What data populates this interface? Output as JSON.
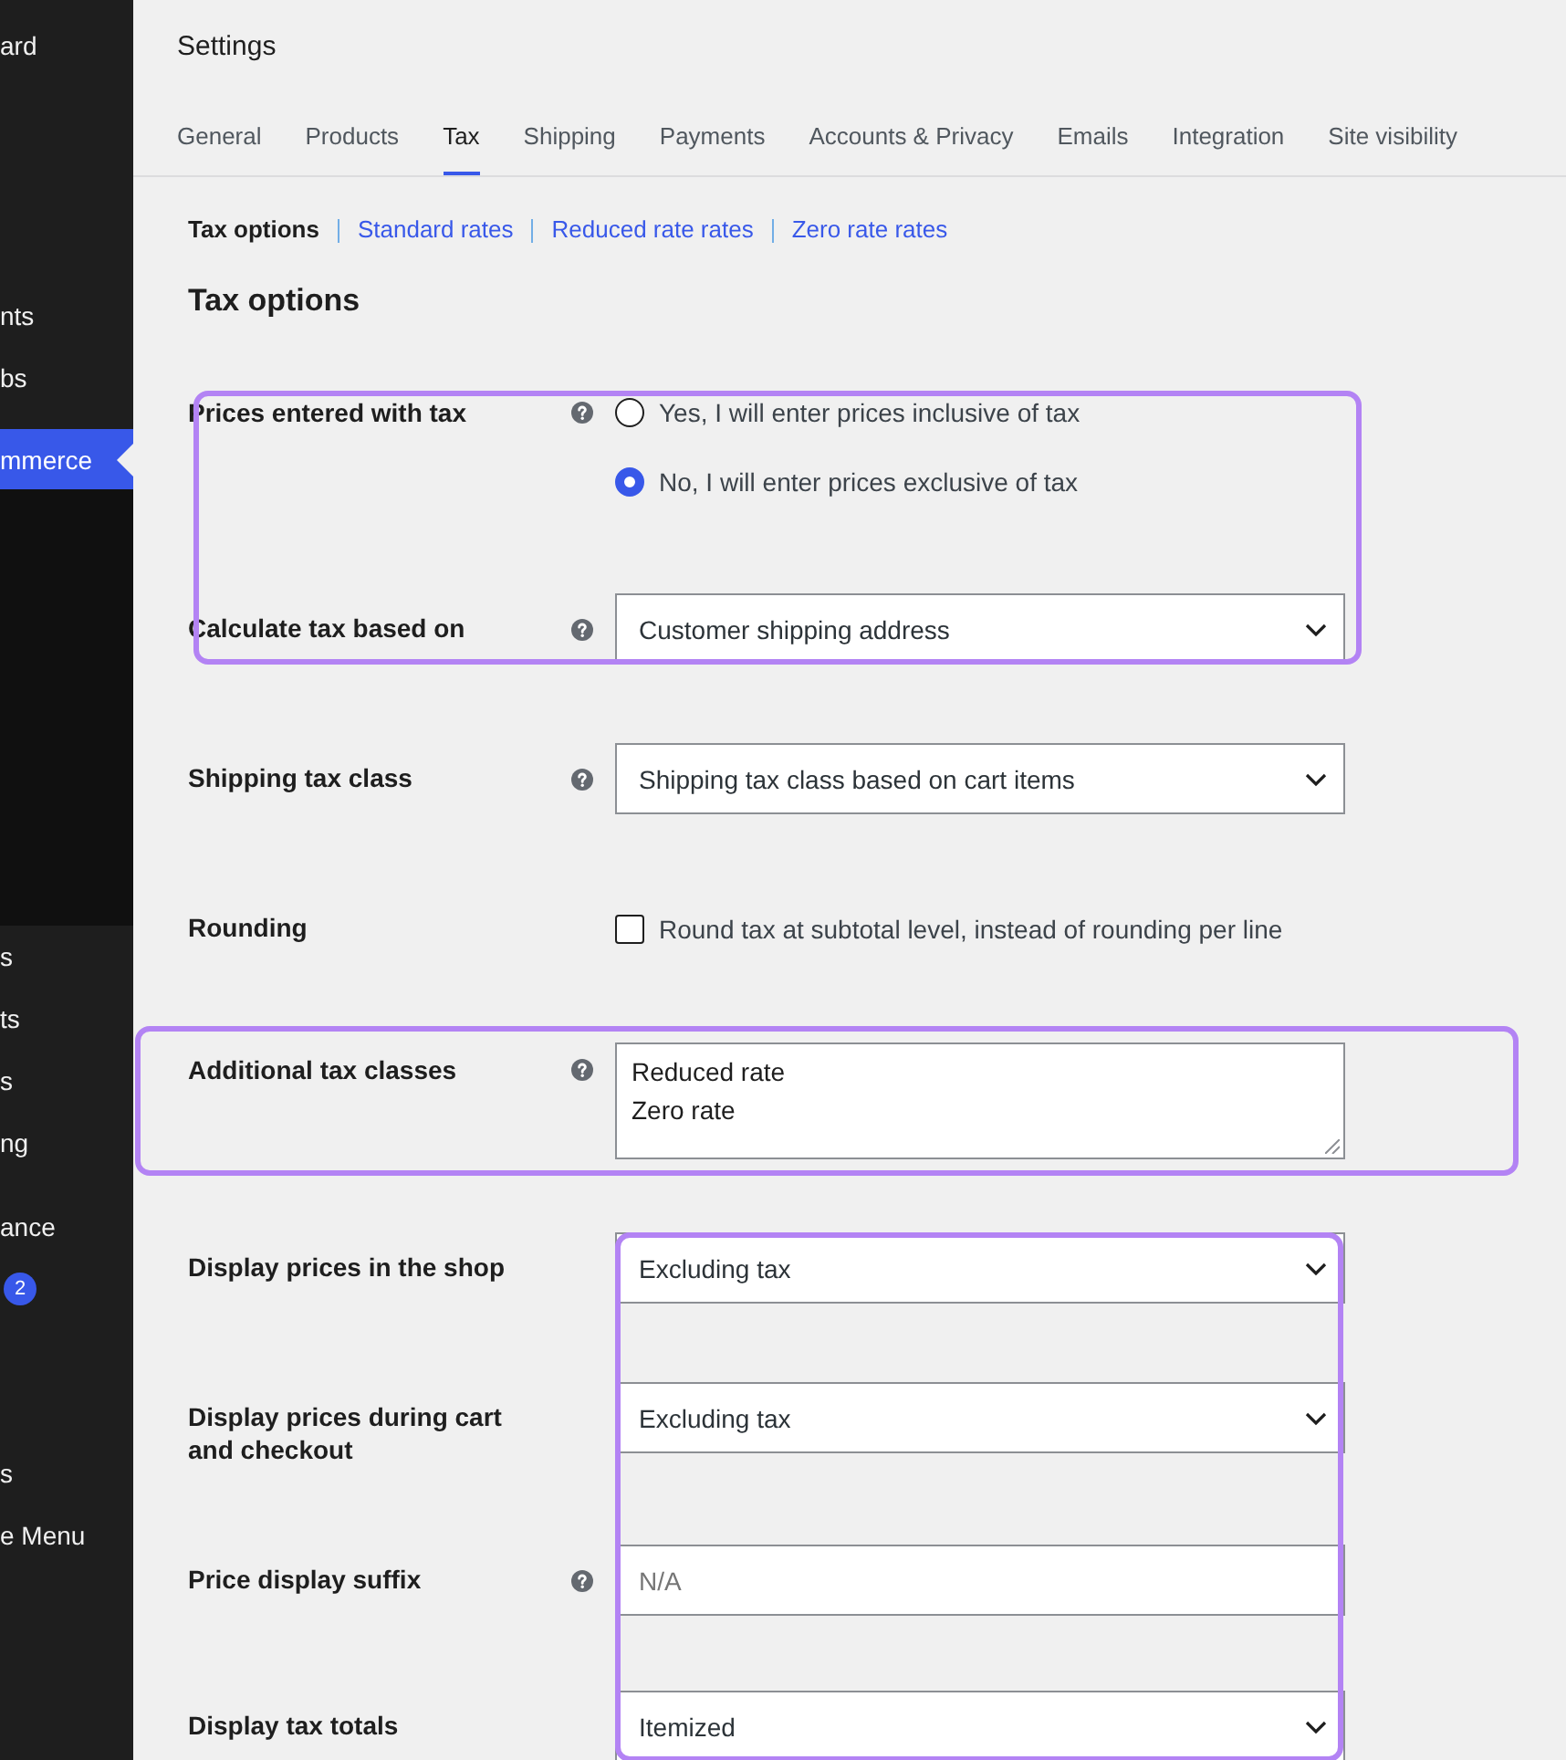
{
  "sidebar": {
    "sections": [
      {
        "items": [
          {
            "label": "ard",
            "selected": false
          }
        ]
      },
      {
        "items": [
          {
            "label": "nts",
            "selected": false
          },
          {
            "label": "bs",
            "selected": false
          }
        ]
      },
      {
        "items": [
          {
            "label": "mmerce",
            "selected": true
          }
        ]
      },
      {
        "items": [
          {
            "label": "s",
            "selected": false
          },
          {
            "label": "ts",
            "selected": false
          },
          {
            "label": "s",
            "selected": false
          },
          {
            "label": "ng",
            "selected": false
          }
        ]
      },
      {
        "items": [
          {
            "label": "ance",
            "selected": false
          },
          {
            "badge": "2",
            "selected": false
          }
        ]
      },
      {
        "items": [
          {
            "label": "s",
            "selected": false
          },
          {
            "label": "e Menu",
            "selected": false
          }
        ]
      }
    ]
  },
  "header": {
    "title": "Settings"
  },
  "tabs": [
    {
      "label": "General",
      "selected": false
    },
    {
      "label": "Products",
      "selected": false
    },
    {
      "label": "Tax",
      "selected": true
    },
    {
      "label": "Shipping",
      "selected": false
    },
    {
      "label": "Payments",
      "selected": false
    },
    {
      "label": "Accounts & Privacy",
      "selected": false
    },
    {
      "label": "Emails",
      "selected": false
    },
    {
      "label": "Integration",
      "selected": false
    },
    {
      "label": "Site visibility",
      "selected": false
    }
  ],
  "subnav": [
    {
      "label": "Tax options",
      "selected": true
    },
    {
      "label": "Standard rates",
      "selected": false
    },
    {
      "label": "Reduced rate rates",
      "selected": false
    },
    {
      "label": "Zero rate rates",
      "selected": false
    }
  ],
  "section_title": "Tax options",
  "form": {
    "groups": [
      {
        "kind": "block",
        "rows": [
          {
            "kind": "radio",
            "label": "Prices entered with tax",
            "help": true,
            "options": [
              {
                "label": "Yes, I will enter prices inclusive of tax",
                "selected": false
              },
              {
                "label": "No, I will enter prices exclusive of tax",
                "selected": true
              }
            ]
          },
          {
            "kind": "select",
            "label": "Calculate tax based on",
            "help": true,
            "value": "Customer shipping address"
          }
        ]
      },
      {
        "kind": "plain",
        "rows": [
          {
            "kind": "select",
            "label": "Shipping tax class",
            "help": true,
            "value": "Shipping tax class based on cart items"
          },
          {
            "kind": "checkbox",
            "label": "Rounding",
            "help": false,
            "checked": false,
            "text": "Round tax at subtotal level, instead of rounding per line"
          }
        ]
      },
      {
        "kind": "wide",
        "rows": [
          {
            "kind": "textarea",
            "label": "Additional tax classes",
            "help": true,
            "value": "Reduced rate\nZero rate"
          }
        ]
      },
      {
        "kind": "fields",
        "rows": [
          {
            "kind": "select",
            "label": "Display prices in the shop",
            "help": false,
            "value": "Excluding tax"
          },
          {
            "kind": "select",
            "label": "Display prices during cart and checkout",
            "help": false,
            "value": "Excluding tax"
          },
          {
            "kind": "input",
            "label": "Price display suffix",
            "help": true,
            "placeholder": "N/A"
          },
          {
            "kind": "select",
            "label": "Display tax totals",
            "help": false,
            "value": "Itemized"
          }
        ]
      }
    ]
  }
}
